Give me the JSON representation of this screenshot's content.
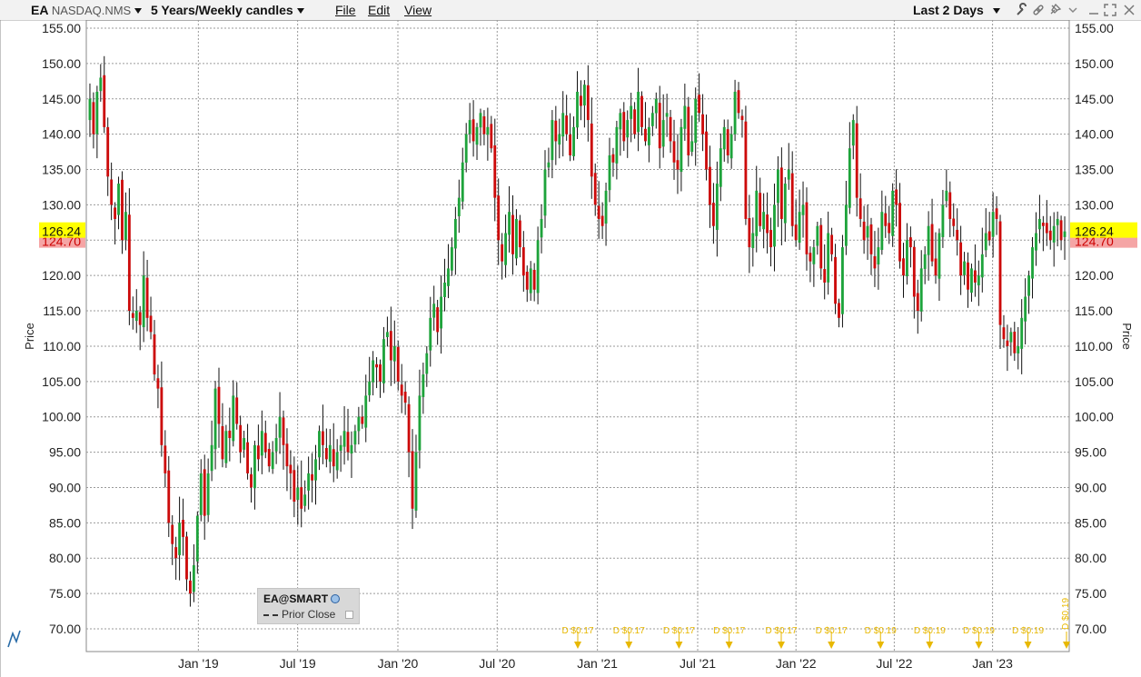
{
  "toolbar": {
    "symbol": "EA",
    "exchange": "NASDAQ.NMS",
    "period": "5 Years/Weekly candles",
    "menu_file": "File",
    "menu_edit": "Edit",
    "menu_view": "View",
    "range": "Last 2 Days"
  },
  "legend": {
    "title": "EA@SMART",
    "prior_close": "Prior Close"
  },
  "colors": {
    "up": "#1ea33b",
    "down": "#cc0a0a",
    "grid": "#9a9a9a",
    "last_price_bg": "#ffff00",
    "prior_close_bg": "#f5a5a5",
    "dividend": "#e8b800"
  },
  "chart_data": {
    "type": "candlestick",
    "ylabel": "Price",
    "ylim": [
      68,
      156
    ],
    "y_ticks": [
      "155.00",
      "150.00",
      "145.00",
      "140.00",
      "135.00",
      "130.00",
      "125.00",
      "120.00",
      "115.00",
      "110.00",
      "105.00",
      "100.00",
      "95.00",
      "90.00",
      "85.00",
      "80.00",
      "75.00",
      "70.00"
    ],
    "x_ticks": [
      {
        "label": "Jan '19",
        "t": 0.114
      },
      {
        "label": "Jul '19",
        "t": 0.215
      },
      {
        "label": "Jan '20",
        "t": 0.317
      },
      {
        "label": "Jul '20",
        "t": 0.418
      },
      {
        "label": "Jan '21",
        "t": 0.52
      },
      {
        "label": "Jul '21",
        "t": 0.622
      },
      {
        "label": "Jan '22",
        "t": 0.722
      },
      {
        "label": "Jul '22",
        "t": 0.822
      },
      {
        "label": "Jan '23",
        "t": 0.922
      }
    ],
    "last_price": "126.24",
    "prior_close": "124.70",
    "dividends": [
      {
        "label": "D $0.17",
        "t": 0.5
      },
      {
        "label": "D $0.17",
        "t": 0.552
      },
      {
        "label": "D $0.17",
        "t": 0.603
      },
      {
        "label": "D $0.17",
        "t": 0.654
      },
      {
        "label": "D $0.17",
        "t": 0.707
      },
      {
        "label": "D $0.17",
        "t": 0.758
      },
      {
        "label": "D $0.19",
        "t": 0.808
      },
      {
        "label": "D $0.19",
        "t": 0.858
      },
      {
        "label": "D $0.19",
        "t": 0.908
      },
      {
        "label": "D $0.19",
        "t": 0.958
      },
      {
        "label": "D $0.19",
        "t": 1.0
      }
    ],
    "series": [
      {
        "name": "EA",
        "close": [
          145,
          140,
          146,
          148,
          141,
          134,
          130,
          128,
          133,
          125,
          129,
          115,
          114,
          115,
          113,
          120,
          114,
          112,
          106,
          104,
          96,
          92,
          85,
          82,
          80,
          85,
          83,
          77,
          75,
          79,
          86,
          92,
          86,
          92,
          96,
          104,
          99,
          94,
          98,
          97,
          103,
          99,
          95,
          97,
          92,
          90,
          96,
          94,
          98,
          95,
          93,
          95,
          97,
          100,
          96,
          93,
          92,
          88,
          90,
          87,
          89,
          92,
          91,
          94,
          98,
          96,
          94,
          96,
          93,
          95,
          96,
          98,
          95,
          96,
          98,
          100,
          99,
          103,
          105,
          108,
          107,
          105,
          111,
          112,
          108,
          110,
          105,
          103,
          102,
          95,
          87,
          95,
          103,
          106,
          109,
          114,
          116,
          112,
          117,
          119,
          121,
          124,
          128,
          131,
          136,
          140,
          142,
          139,
          141,
          143,
          140,
          141,
          138,
          131,
          125,
          122,
          126,
          129,
          123,
          128,
          124,
          120,
          118,
          121,
          118,
          125,
          128,
          135,
          136,
          142,
          139,
          140,
          143,
          140,
          137,
          141,
          146,
          144,
          147,
          142,
          134,
          130,
          128,
          127,
          132,
          137,
          136,
          141,
          143,
          139,
          142,
          144,
          140,
          146,
          141,
          139,
          141,
          143,
          145,
          138,
          142,
          143,
          139,
          136,
          135,
          141,
          144,
          137,
          139,
          145,
          143,
          140,
          135,
          130,
          127,
          133,
          138,
          141,
          137,
          140,
          146,
          143,
          142,
          128,
          124,
          126,
          132,
          127,
          129,
          126,
          124,
          130,
          135,
          128,
          133,
          135,
          127,
          125,
          129,
          130,
          123,
          122,
          124,
          127,
          121,
          119,
          126,
          123,
          116,
          114,
          124,
          130,
          138,
          142,
          131,
          128,
          125,
          127,
          123,
          121,
          124,
          129,
          127,
          126,
          132,
          130,
          122,
          120,
          125,
          124,
          117,
          115,
          121,
          123,
          127,
          122,
          120,
          126,
          130,
          132,
          128,
          127,
          125,
          120,
          122,
          118,
          121,
          119,
          120,
          123,
          126,
          125,
          129,
          128,
          113,
          111,
          110,
          112,
          109,
          110,
          114,
          117,
          120,
          124,
          126,
          128,
          127,
          126,
          125,
          127,
          128,
          125,
          126.24
        ]
      }
    ]
  }
}
